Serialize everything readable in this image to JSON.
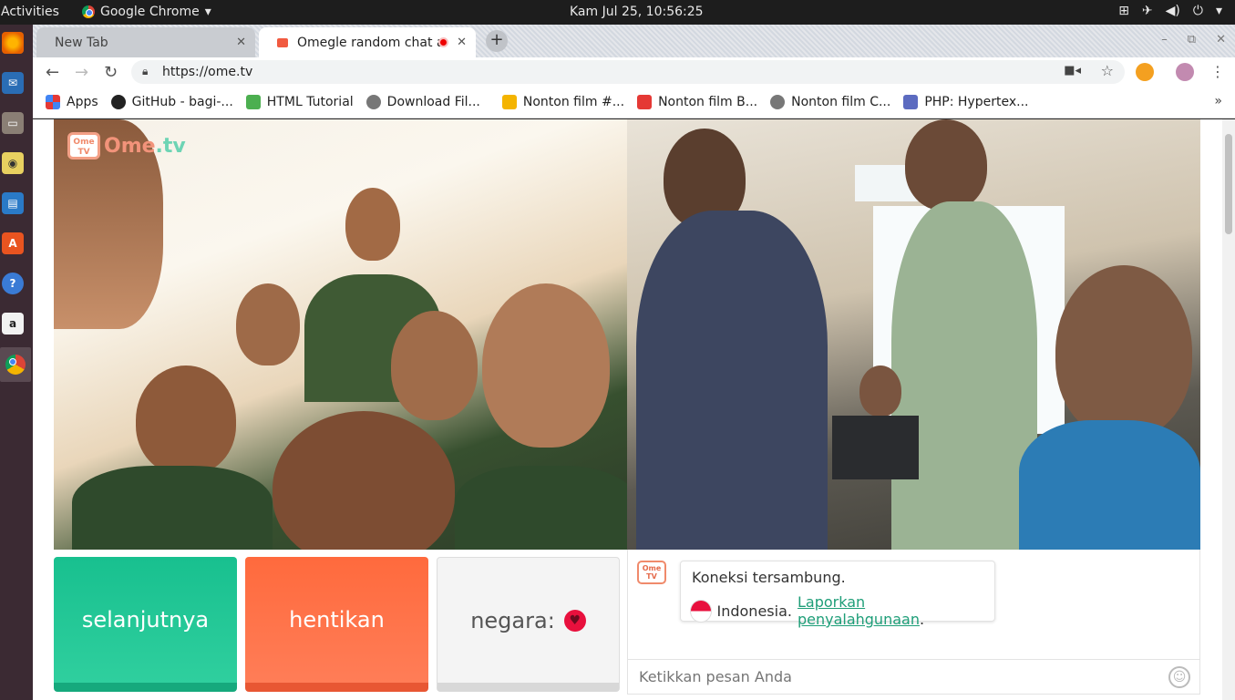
{
  "topbar": {
    "activities": "Activities",
    "app_name": "Google Chrome",
    "app_menu_arrow": "▾",
    "clock": "Kam Jul 25, 10:56:25",
    "tray_icons": [
      "network-icon",
      "airplane-icon",
      "volume-icon",
      "power-icon",
      "chevron-down-icon"
    ]
  },
  "launcher": {
    "items": [
      "firefox",
      "thunderbird",
      "files",
      "rhythmbox",
      "libreoffice-writer",
      "software-center",
      "help",
      "amazon",
      "chrome"
    ]
  },
  "tabs": [
    {
      "label": "New Tab",
      "close": "✕"
    },
    {
      "label": "Omegle random chat a",
      "close": "✕"
    }
  ],
  "newtab_label": "+",
  "window_controls": [
    "–",
    "⧉",
    "✕"
  ],
  "toolbar": {
    "back": "←",
    "forward": "→",
    "reload": "↻",
    "url": "https://ome.tv"
  },
  "bookmarks": [
    {
      "label": "Apps",
      "color": "#e53935"
    },
    {
      "label": "GitHub - bagi-...",
      "color": "#222222"
    },
    {
      "label": "HTML Tutorial",
      "color": "#4caf50"
    },
    {
      "label": "Download Fil...",
      "color": "#666666"
    },
    {
      "label": "Nonton film #...",
      "color": "#f4b400"
    },
    {
      "label": "Nonton film B...",
      "color": "#e53935"
    },
    {
      "label": "Nonton film C...",
      "color": "#666666"
    },
    {
      "label": "PHP: Hypertex...",
      "color": "#5c6bc0"
    }
  ],
  "bookmarks_more": "»",
  "logo": {
    "top": "Ome",
    "bottom": "TV",
    "word_a": "Ome",
    "word_b": ".tv"
  },
  "buttons": {
    "next": "selanjutnya",
    "stop": "hentikan",
    "country": "negara:",
    "country_icon": "♥"
  },
  "chat": {
    "logo_top": "Ome",
    "logo_bottom": "TV",
    "status": "Koneksi tersambung.",
    "country": "Indonesia.",
    "report_link": "Laporkan penyalahgunaan",
    "report_suffix": ".",
    "input_placeholder": "Ketikkan pesan Anda",
    "emoji": "☺"
  },
  "colors": {
    "next": "#18c08f",
    "stop": "#ff6a3d",
    "accent_link": "#1e9e78",
    "brand": "#f2937a"
  }
}
